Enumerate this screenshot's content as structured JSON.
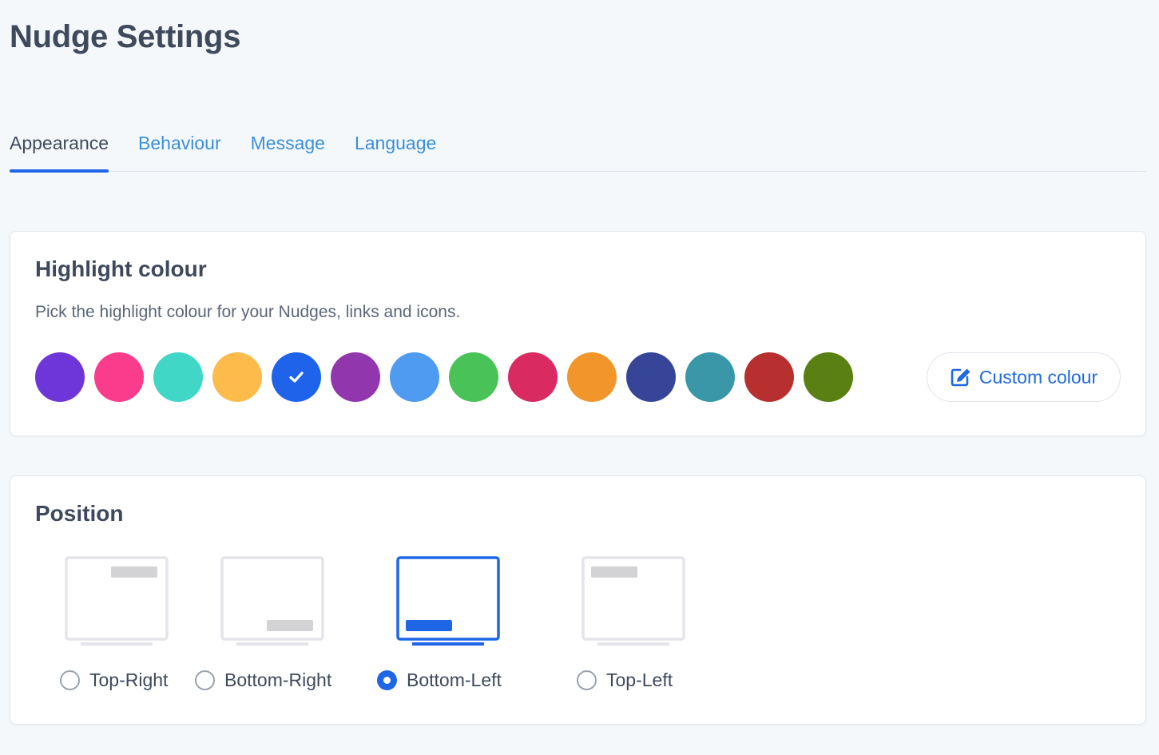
{
  "page_title": "Nudge Settings",
  "tabs": [
    {
      "label": "Appearance",
      "active": true
    },
    {
      "label": "Behaviour",
      "active": false
    },
    {
      "label": "Message",
      "active": false
    },
    {
      "label": "Language",
      "active": false
    }
  ],
  "highlight": {
    "title": "Highlight colour",
    "description": "Pick the highlight colour for your Nudges, links and icons.",
    "swatches": [
      {
        "color": "#6e36d8",
        "selected": false
      },
      {
        "color": "#fb3b8c",
        "selected": false
      },
      {
        "color": "#41d7c7",
        "selected": false
      },
      {
        "color": "#fdbb4c",
        "selected": false
      },
      {
        "color": "#1f63ea",
        "selected": true
      },
      {
        "color": "#9236ad",
        "selected": false
      },
      {
        "color": "#4e9bf1",
        "selected": false
      },
      {
        "color": "#49c357",
        "selected": false
      },
      {
        "color": "#d92a62",
        "selected": false
      },
      {
        "color": "#f2962b",
        "selected": false
      },
      {
        "color": "#374598",
        "selected": false
      },
      {
        "color": "#3a97a8",
        "selected": false
      },
      {
        "color": "#b82f30",
        "selected": false
      },
      {
        "color": "#5a8014",
        "selected": false
      }
    ],
    "custom_button_label": "Custom colour",
    "custom_button_icon": "edit-icon"
  },
  "position": {
    "title": "Position",
    "options": [
      {
        "label": "Top-Right",
        "placement": "top-right",
        "selected": false
      },
      {
        "label": "Bottom-Right",
        "placement": "bottom-right",
        "selected": false
      },
      {
        "label": "Bottom-Left",
        "placement": "bottom-left",
        "selected": true
      },
      {
        "label": "Top-Left",
        "placement": "top-left",
        "selected": false
      }
    ]
  },
  "colors": {
    "accent": "#1e66e6",
    "link": "#3a8fd9",
    "illustration_inactive": "#e4e4ea",
    "illustration_bar": "#d3d3d6"
  }
}
